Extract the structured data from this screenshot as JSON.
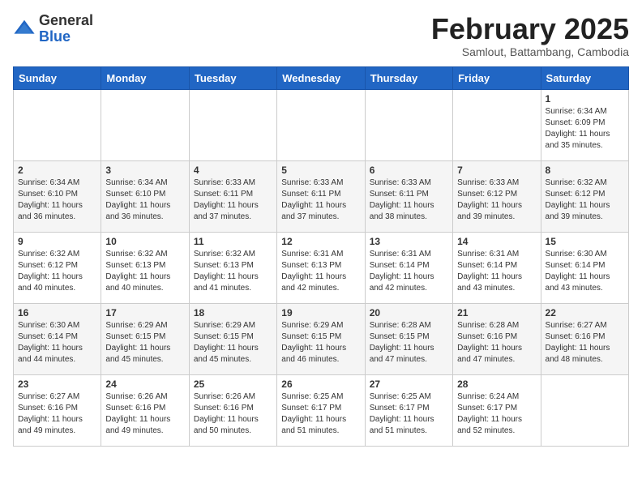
{
  "logo": {
    "general": "General",
    "blue": "Blue"
  },
  "title": "February 2025",
  "subtitle": "Samlout, Battambang, Cambodia",
  "days_of_week": [
    "Sunday",
    "Monday",
    "Tuesday",
    "Wednesday",
    "Thursday",
    "Friday",
    "Saturday"
  ],
  "weeks": [
    [
      {
        "day": "",
        "info": ""
      },
      {
        "day": "",
        "info": ""
      },
      {
        "day": "",
        "info": ""
      },
      {
        "day": "",
        "info": ""
      },
      {
        "day": "",
        "info": ""
      },
      {
        "day": "",
        "info": ""
      },
      {
        "day": "1",
        "info": "Sunrise: 6:34 AM\nSunset: 6:09 PM\nDaylight: 11 hours and 35 minutes."
      }
    ],
    [
      {
        "day": "2",
        "info": "Sunrise: 6:34 AM\nSunset: 6:10 PM\nDaylight: 11 hours and 36 minutes."
      },
      {
        "day": "3",
        "info": "Sunrise: 6:34 AM\nSunset: 6:10 PM\nDaylight: 11 hours and 36 minutes."
      },
      {
        "day": "4",
        "info": "Sunrise: 6:33 AM\nSunset: 6:11 PM\nDaylight: 11 hours and 37 minutes."
      },
      {
        "day": "5",
        "info": "Sunrise: 6:33 AM\nSunset: 6:11 PM\nDaylight: 11 hours and 37 minutes."
      },
      {
        "day": "6",
        "info": "Sunrise: 6:33 AM\nSunset: 6:11 PM\nDaylight: 11 hours and 38 minutes."
      },
      {
        "day": "7",
        "info": "Sunrise: 6:33 AM\nSunset: 6:12 PM\nDaylight: 11 hours and 39 minutes."
      },
      {
        "day": "8",
        "info": "Sunrise: 6:32 AM\nSunset: 6:12 PM\nDaylight: 11 hours and 39 minutes."
      }
    ],
    [
      {
        "day": "9",
        "info": "Sunrise: 6:32 AM\nSunset: 6:12 PM\nDaylight: 11 hours and 40 minutes."
      },
      {
        "day": "10",
        "info": "Sunrise: 6:32 AM\nSunset: 6:13 PM\nDaylight: 11 hours and 40 minutes."
      },
      {
        "day": "11",
        "info": "Sunrise: 6:32 AM\nSunset: 6:13 PM\nDaylight: 11 hours and 41 minutes."
      },
      {
        "day": "12",
        "info": "Sunrise: 6:31 AM\nSunset: 6:13 PM\nDaylight: 11 hours and 42 minutes."
      },
      {
        "day": "13",
        "info": "Sunrise: 6:31 AM\nSunset: 6:14 PM\nDaylight: 11 hours and 42 minutes."
      },
      {
        "day": "14",
        "info": "Sunrise: 6:31 AM\nSunset: 6:14 PM\nDaylight: 11 hours and 43 minutes."
      },
      {
        "day": "15",
        "info": "Sunrise: 6:30 AM\nSunset: 6:14 PM\nDaylight: 11 hours and 43 minutes."
      }
    ],
    [
      {
        "day": "16",
        "info": "Sunrise: 6:30 AM\nSunset: 6:14 PM\nDaylight: 11 hours and 44 minutes."
      },
      {
        "day": "17",
        "info": "Sunrise: 6:29 AM\nSunset: 6:15 PM\nDaylight: 11 hours and 45 minutes."
      },
      {
        "day": "18",
        "info": "Sunrise: 6:29 AM\nSunset: 6:15 PM\nDaylight: 11 hours and 45 minutes."
      },
      {
        "day": "19",
        "info": "Sunrise: 6:29 AM\nSunset: 6:15 PM\nDaylight: 11 hours and 46 minutes."
      },
      {
        "day": "20",
        "info": "Sunrise: 6:28 AM\nSunset: 6:15 PM\nDaylight: 11 hours and 47 minutes."
      },
      {
        "day": "21",
        "info": "Sunrise: 6:28 AM\nSunset: 6:16 PM\nDaylight: 11 hours and 47 minutes."
      },
      {
        "day": "22",
        "info": "Sunrise: 6:27 AM\nSunset: 6:16 PM\nDaylight: 11 hours and 48 minutes."
      }
    ],
    [
      {
        "day": "23",
        "info": "Sunrise: 6:27 AM\nSunset: 6:16 PM\nDaylight: 11 hours and 49 minutes."
      },
      {
        "day": "24",
        "info": "Sunrise: 6:26 AM\nSunset: 6:16 PM\nDaylight: 11 hours and 49 minutes."
      },
      {
        "day": "25",
        "info": "Sunrise: 6:26 AM\nSunset: 6:16 PM\nDaylight: 11 hours and 50 minutes."
      },
      {
        "day": "26",
        "info": "Sunrise: 6:25 AM\nSunset: 6:17 PM\nDaylight: 11 hours and 51 minutes."
      },
      {
        "day": "27",
        "info": "Sunrise: 6:25 AM\nSunset: 6:17 PM\nDaylight: 11 hours and 51 minutes."
      },
      {
        "day": "28",
        "info": "Sunrise: 6:24 AM\nSunset: 6:17 PM\nDaylight: 11 hours and 52 minutes."
      },
      {
        "day": "",
        "info": ""
      }
    ]
  ]
}
